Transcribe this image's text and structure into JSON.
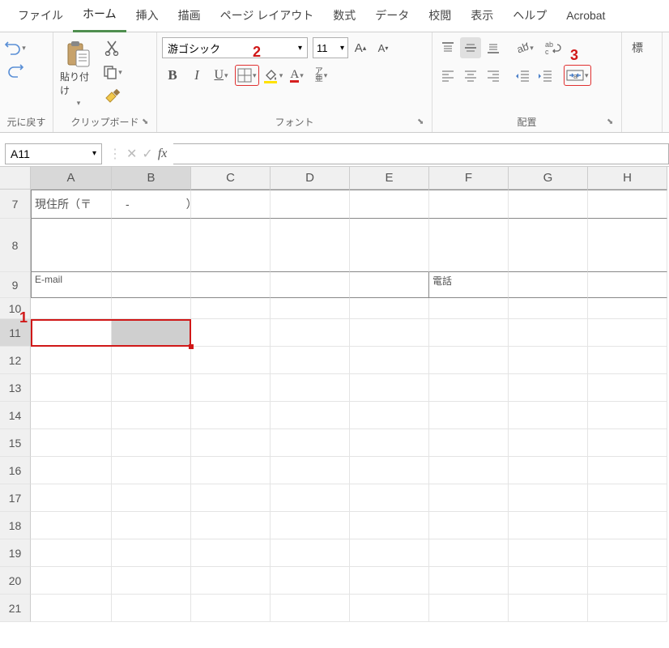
{
  "tabs": {
    "file": "ファイル",
    "home": "ホーム",
    "insert": "挿入",
    "draw": "描画",
    "page_layout": "ページ レイアウト",
    "formulas": "数式",
    "data": "データ",
    "review": "校閲",
    "view": "表示",
    "help": "ヘルプ",
    "acrobat": "Acrobat"
  },
  "groups": {
    "undo": "元に戻す",
    "clipboard": "クリップボード",
    "font": "フォント",
    "alignment": "配置"
  },
  "clipboard": {
    "paste": "貼り付け"
  },
  "font": {
    "name": "游ゴシック",
    "size": "11",
    "bold": "B",
    "italic": "I",
    "underline": "U",
    "ruby": "ア\n亜"
  },
  "namebox": "A11",
  "fx_label": "fx",
  "columns": [
    "A",
    "B",
    "C",
    "D",
    "E",
    "F",
    "G",
    "H"
  ],
  "rows": [
    "7",
    "8",
    "9",
    "10",
    "11",
    "12",
    "13",
    "14",
    "15",
    "16",
    "17",
    "18",
    "19",
    "20",
    "21"
  ],
  "cells": {
    "A7": "現住所（〒　　　-　　　　　）",
    "A9": "E-mail",
    "F9": "電話"
  },
  "annotations": {
    "a1": "1",
    "a2": "2",
    "a3": "3"
  },
  "partial": {
    "std": "標"
  }
}
